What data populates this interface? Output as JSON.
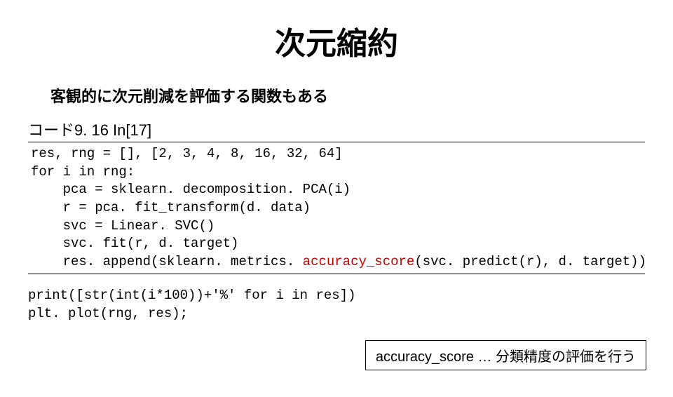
{
  "title": "次元縮約",
  "subtitle": "客観的に次元削減を評価する関数もある",
  "code_label": "コード9. 16 In[17]",
  "code": {
    "l1": "res, rng = [], [2, 3, 4, 8, 16, 32, 64]",
    "l2": "for i in rng:",
    "l3": "    pca = sklearn. decomposition. PCA(i)",
    "l4": "    r = pca. fit_transform(d. data)",
    "l5": "    svc = Linear. SVC()",
    "l6": "    svc. fit(r, d. target)",
    "l7a": "    res. append(sklearn. metrics. ",
    "l7b": "accuracy_score",
    "l7c": "(svc. predict(r), d. target))"
  },
  "code_after": {
    "l1": "print([str(int(i*100))+'%' for i in res])",
    "l2": "plt. plot(rng, res);"
  },
  "note": "accuracy_score … 分類精度の評価を行う"
}
